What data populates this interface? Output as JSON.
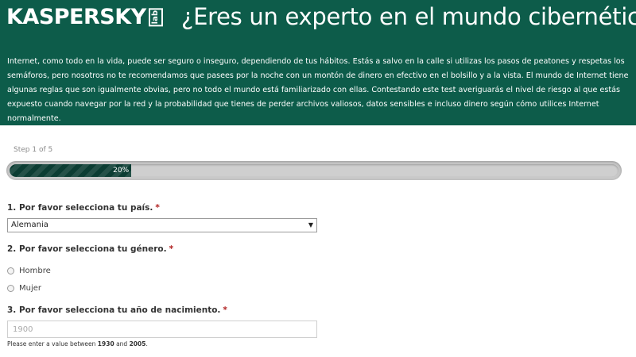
{
  "header": {
    "logo_text": "KASPERSKY",
    "logo_lab": "lab",
    "title": "¿Eres un experto en el mundo cibernético?",
    "intro": "Internet, como todo en la vida, puede ser seguro o inseguro, dependiendo de tus hábitos. Estás a salvo en la calle si utilizas los pasos de peatones y respetas los semáforos, pero nosotros no te recomendamos que pasees por la noche con un montón de dinero en efectivo en el bolsillo y a la vista. El mundo de Internet tiene algunas reglas que son igualmente obvias, pero no todo el mundo está familiarizado con ellas. Contestando este test averiguarás el nivel de riesgo al que estás expuesto cuando navegar por la red y la probabilidad que tienes de perder archivos valiosos, datos sensibles e incluso dinero según cómo utilices Internet normalmente.",
    "background_color": "#0d5c4a"
  },
  "progress": {
    "step_text": "Step 1 of 5",
    "percent_label": "20%",
    "fraction": 0.2,
    "fill_color": "#0c3d33"
  },
  "questions": {
    "q1": {
      "label": "1. Por favor selecciona tu país.",
      "required_mark": "*",
      "selected_value": "Alemania",
      "arrow_icon": "▼"
    },
    "q2": {
      "label": "2. Por favor selecciona tu género.",
      "required_mark": "*",
      "options": [
        "Hombre",
        "Mujer"
      ]
    },
    "q3": {
      "label": "3. Por favor selecciona tu año de nacimiento.",
      "required_mark": "*",
      "placeholder": "1900",
      "hint_prefix": "Please enter a value between",
      "hint_min": "1930",
      "hint_and": "and",
      "hint_max": "2005",
      "hint_suffix": "."
    }
  }
}
